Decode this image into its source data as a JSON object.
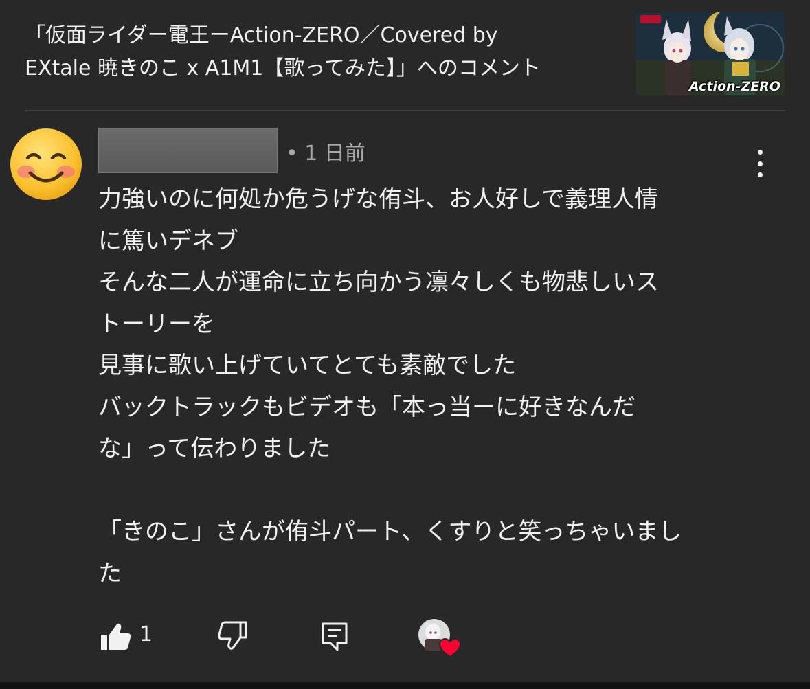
{
  "video": {
    "title_line1": "「仮面ライダー電王ーAction-ZERO／Covered by",
    "title_line2": "EXtale 暁きのこ x A1M1【歌ってみた】」へのコメント",
    "thumbnail_label": "Action-ZERO"
  },
  "comment": {
    "avatar_icon": "smiling-face-emoji-icon",
    "author_redacted": true,
    "timestamp": "• 1 日前",
    "lines": [
      "力強いのに何処か危うげな侑斗、お人好しで義理人情",
      "に篤いデネブ",
      "そんな二人が運命に立ち向かう凛々しくも物悲しいス",
      "トーリーを",
      "見事に歌い上げていてとても素敵でした",
      "バックトラックもビデオも「本っ当ーに好きなんだ",
      "な」って伝わりました",
      "",
      "「きのこ」さんが侑斗パート、くすりと笑っちゃいまし",
      "た"
    ]
  },
  "actions": {
    "like_icon": "thumbs-up-icon",
    "like_count": "1",
    "dislike_icon": "thumbs-down-icon",
    "reply_icon": "reply-comment-icon",
    "creator_heart_icon": "creator-heart-icon",
    "heart_color": "#ff0033"
  },
  "colors": {
    "background": "#282828",
    "text_primary": "#f1f1f1",
    "text_secondary": "#a8a8a8",
    "divider": "#3e3e3e"
  }
}
